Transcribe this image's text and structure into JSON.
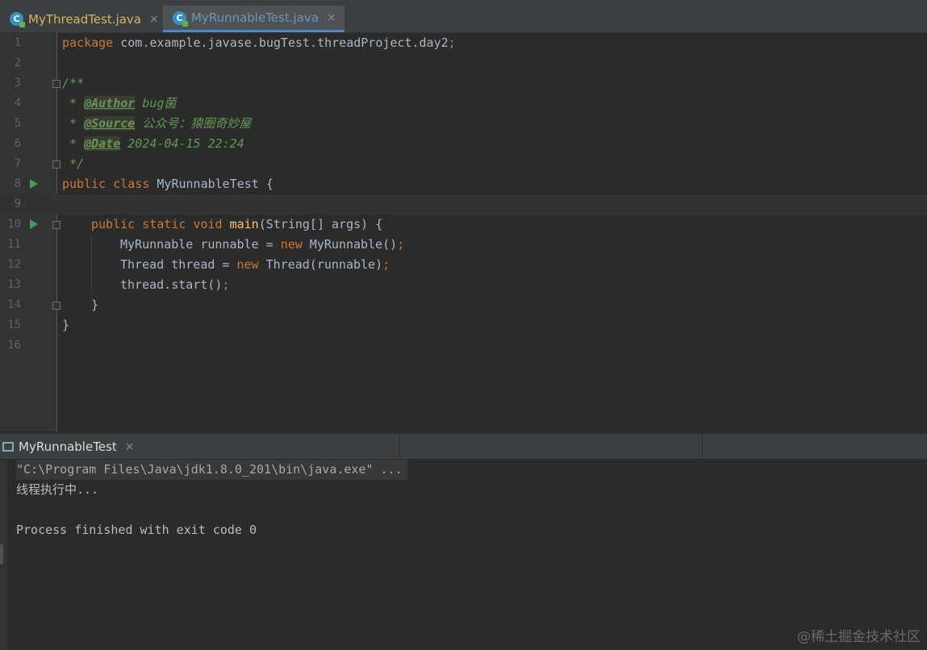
{
  "tabs": [
    {
      "label": "MyThreadTest.java",
      "icon": "java-class-icon"
    },
    {
      "label": "MyRunnableTest.java",
      "icon": "java-class-icon"
    }
  ],
  "close_glyph": "×",
  "editor": {
    "lines": [
      {
        "num": "1"
      },
      {
        "num": "2"
      },
      {
        "num": "3"
      },
      {
        "num": "4"
      },
      {
        "num": "5"
      },
      {
        "num": "6"
      },
      {
        "num": "7"
      },
      {
        "num": "8"
      },
      {
        "num": "9"
      },
      {
        "num": "10"
      },
      {
        "num": "11"
      },
      {
        "num": "12"
      },
      {
        "num": "13"
      },
      {
        "num": "14"
      },
      {
        "num": "15"
      },
      {
        "num": "16"
      }
    ],
    "code": {
      "l1_kw": "package",
      "l1_rest": " com.example.javase.bugTest.threadProject.day2",
      "l1_semi": ";",
      "l3": "/**",
      "l4_pre": " * ",
      "l4_tag": "@Author",
      "l4_val": " bug菌",
      "l5_pre": " * ",
      "l5_tag": "@Source",
      "l5_val": " 公众号：猿圈奇妙屋",
      "l6_pre": " * ",
      "l6_tag": "@Date",
      "l6_val": " 2024-04-15 22:24",
      "l7": " */",
      "l8_kw": "public class",
      "l8_rest": " MyRunnableTest {",
      "l10_kw": "public static void",
      "l10_fn": "main",
      "l10_rest": "(String[] args) {",
      "l11_a": "MyRunnable runnable = ",
      "l11_kw": "new",
      "l11_b": " MyRunnable()",
      "l11_semi": ";",
      "l12_a": "Thread thread = ",
      "l12_kw": "new",
      "l12_b": " Thread(runnable)",
      "l12_semi": ";",
      "l13_a": "thread.start()",
      "l13_semi": ";",
      "l14": "}",
      "l15": "}"
    }
  },
  "run_panel": {
    "tab_label": "MyRunnableTest",
    "console": {
      "command": "\"C:\\Program Files\\Java\\jdk1.8.0_201\\bin\\java.exe\" ...",
      "output": "线程执行中...",
      "exit": "Process finished with exit code 0"
    }
  },
  "watermark": "@稀土掘金技术社区",
  "colors": {
    "background": "#2b2b2b",
    "keyword": "#cc7832",
    "function": "#ffc66d",
    "comment": "#629755",
    "text": "#a9b7c6",
    "active_tab_underline": "#4a88c7"
  }
}
